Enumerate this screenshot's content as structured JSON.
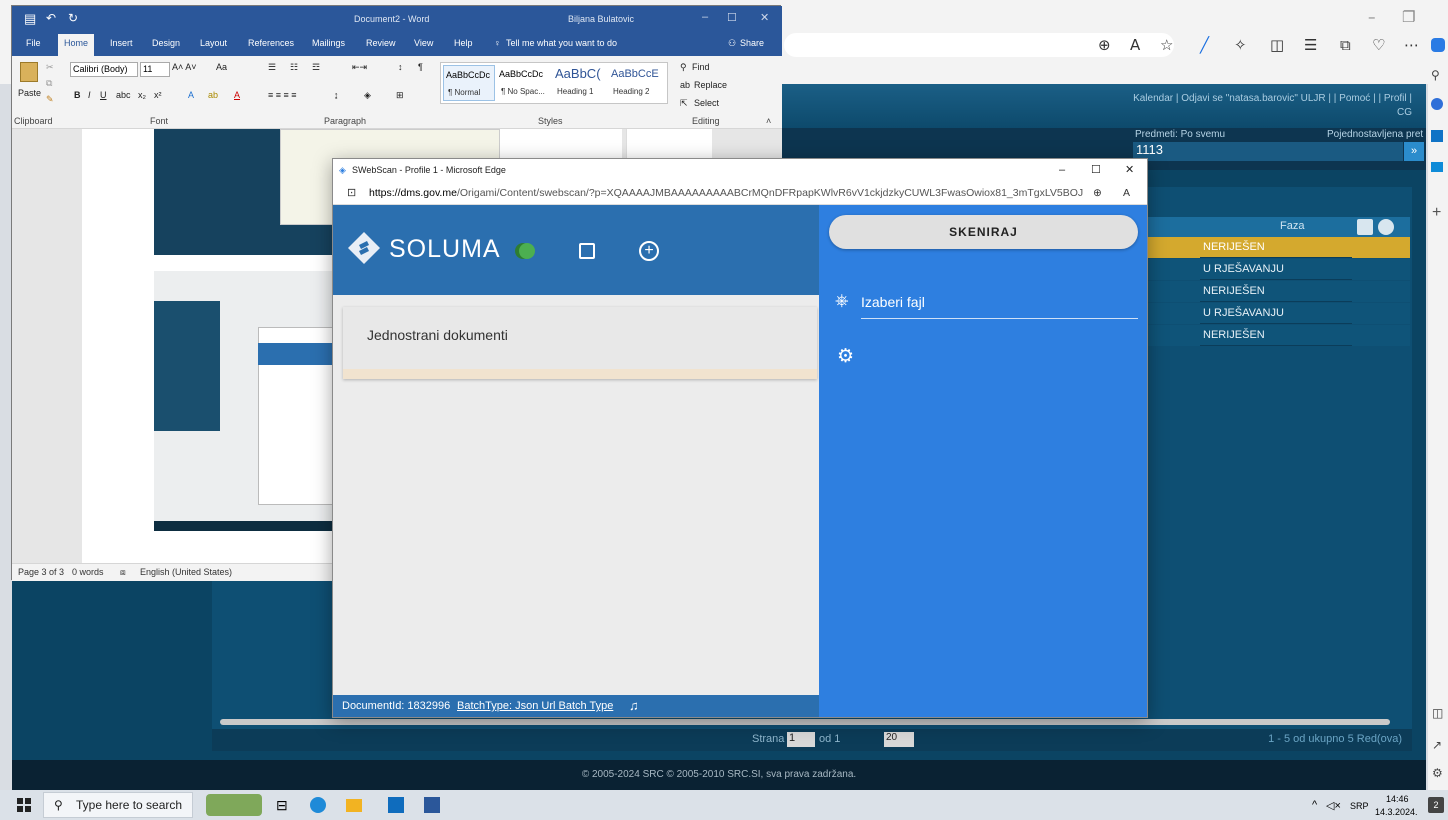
{
  "browser": {
    "right_icons": [
      "zoom-icon",
      "read-aloud-icon",
      "favorite-icon",
      "pen-icon",
      "extensions-icon",
      "split-icon",
      "favorites-list-icon",
      "collections-icon",
      "performance-icon",
      "more-icon"
    ]
  },
  "webapp": {
    "header_links": "Kalendar | Odjavi se \"natasa.barovic\" ULJR | | Pomoć | | Profil | CG",
    "predmeti_label": "Predmeti: Po svemu",
    "pojednostavljena_label": "Pojednostavljena pret",
    "search_value": "1113",
    "search_btn": "»",
    "faza_header": "Faza",
    "faza_rows": [
      "NERIJEŠEN",
      "U RJEŠAVANJU",
      "NERIJEŠEN",
      "U RJEŠAVANJU",
      "NERIJEŠEN"
    ],
    "pager_strana": "Strana",
    "pager_page": "1",
    "pager_od": "od 1",
    "pager_size": "20",
    "pager_total": "1 - 5 od ukupno 5 Red(ova)",
    "copyright": "© 2005-2024 SRC © 2005-2010 SRC.SI, sva prava zadržana."
  },
  "word": {
    "title": "Document2 - Word",
    "user": "Biljana Bulatovic",
    "tabs": [
      "File",
      "Home",
      "Insert",
      "Design",
      "Layout",
      "References",
      "Mailings",
      "Review",
      "View",
      "Help"
    ],
    "tell_me": "Tell me what you want to do",
    "share": "Share",
    "font_name": "Calibri (Body)",
    "font_size": "11",
    "styles": [
      {
        "preview": "AaBbCcDc",
        "name": "¶ Normal"
      },
      {
        "preview": "AaBbCcDc",
        "name": "¶ No Spac..."
      },
      {
        "preview": "AaBbC(",
        "name": "Heading 1"
      },
      {
        "preview": "AaBbCcE",
        "name": "Heading 2"
      }
    ],
    "editing": {
      "find": "Find",
      "replace": "Replace",
      "select": "Select"
    },
    "groups": {
      "clipboard": "Clipboard",
      "font": "Font",
      "paragraph": "Paragraph",
      "styles": "Styles",
      "editing": "Editing"
    },
    "paste": "Paste",
    "status": {
      "page": "Page 3 of 3",
      "words": "0 words",
      "language": "English (United States)"
    }
  },
  "scan": {
    "title": "SWebScan - Profile 1 - Microsoft Edge",
    "url_host": "https://dms.gov.me",
    "url_path": "/Origami/Content/swebscan/?p=XQAAAAJMBAAAAAAAAABCrMQnDFRpapKWlvR6vV1ckjdzkyCUWL3FwasOwiox81_3mTgxLV5BOJ_...",
    "logo_text": "SOLUMA",
    "doc_title": "Jednostrani dokumenti",
    "skeniraj": "SKENIRAJ",
    "file_placeholder": "Izaberi fajl",
    "footer_docid": "DocumentId: 1832996",
    "footer_batch": "BatchType: Json Url Batch Type"
  },
  "taskbar": {
    "search_placeholder": "Type here to search",
    "lang": "SRP",
    "time": "14:46",
    "date": "14.3.2024.",
    "notifications": "2"
  },
  "colors": {
    "word_blue": "#2b579a",
    "scan_blue": "#2e7fe0",
    "scan_header": "#2b6faf",
    "app_navy": "#0b4463",
    "faza_highlight": "#d4a92e"
  }
}
